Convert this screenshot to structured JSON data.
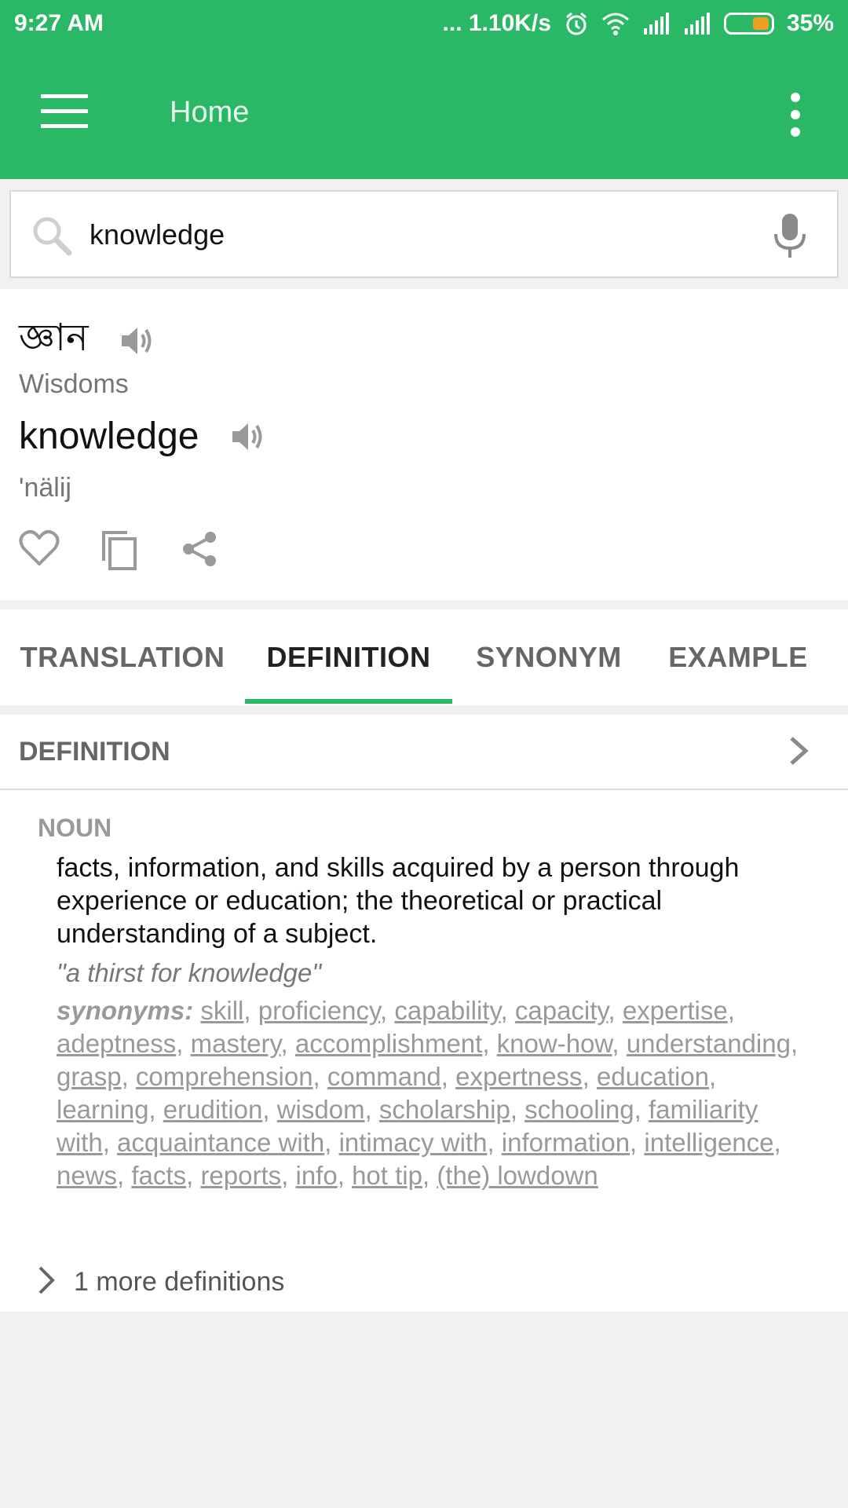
{
  "status_bar": {
    "time": "9:27 AM",
    "net_speed": "... 1.10K/s",
    "battery_pct": "35%",
    "battery_level": 0.35,
    "icons": [
      "alarm-icon",
      "wifi-icon",
      "signal-icon",
      "signal-icon",
      "battery-icon"
    ]
  },
  "app_bar": {
    "title": "Home",
    "left_icon": "menu-icon",
    "right_icon": "more-vert-icon",
    "color": "#2bb866"
  },
  "search": {
    "value": "knowledge",
    "placeholder": ""
  },
  "word": {
    "bengali": "জ্ঞান",
    "transliteration": "Wisdoms",
    "english": "knowledge",
    "pronunciation": "'nälij"
  },
  "tabs": [
    {
      "label": "TRANSLATION",
      "active": false
    },
    {
      "label": "DEFINITION",
      "active": true
    },
    {
      "label": "SYNONYM",
      "active": false
    },
    {
      "label": "EXAMPLE",
      "active": false
    }
  ],
  "definition": {
    "header": "DEFINITION",
    "part_of_speech": "NOUN",
    "text": "facts, information, and skills acquired by a person through experience or education; the theoretical or practical understanding of a subject.",
    "example": "\"a thirst for knowledge\"",
    "synonyms_label": "synonyms:",
    "synonyms": [
      "skill",
      "proficiency",
      "capability",
      "capacity",
      "expertise",
      "adeptness",
      "mastery",
      "accomplishment",
      "know-how",
      "understanding",
      "grasp",
      "comprehension",
      "command",
      "expertness",
      "education",
      "learning",
      "erudition",
      "wisdom",
      "scholarship",
      "schooling",
      "familiarity with",
      "acquaintance with",
      "intimacy with",
      "information",
      "intelligence",
      "news",
      "facts",
      "reports",
      "info",
      "hot tip",
      "(the) lowdown"
    ],
    "more_label": "1 more definitions"
  },
  "colors": {
    "accent": "#2bb866",
    "background": "#f1f1f1"
  }
}
